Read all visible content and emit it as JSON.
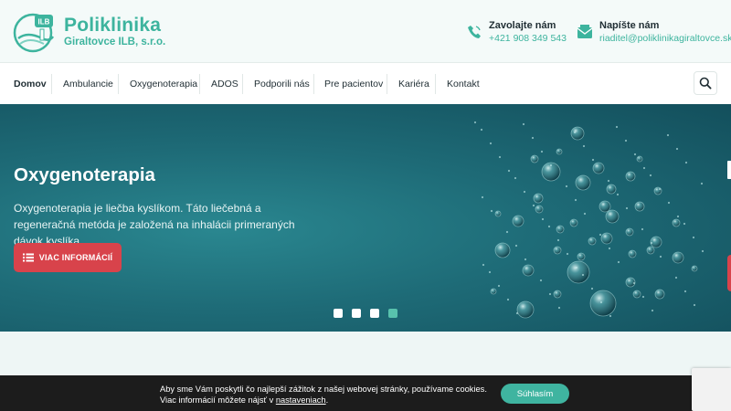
{
  "brand": {
    "title": "Poliklinika",
    "subtitle": "Giraltovce ILB, s.r.o.",
    "logo_text": "ILB"
  },
  "contact": {
    "phone": {
      "title": "Zavolajte nám",
      "value": "+421 908 349 543",
      "icon": "phone-icon"
    },
    "email": {
      "title": "Napíšte nám",
      "value": "riaditel@poliklinikagiraltovce.sk",
      "icon": "mail-icon"
    }
  },
  "nav": {
    "items": [
      {
        "label": "Domov",
        "active": true
      },
      {
        "label": "Ambulancie"
      },
      {
        "label": "Oxygenoterapia"
      },
      {
        "label": "ADOS"
      },
      {
        "label": "Podporili nás"
      },
      {
        "label": "Pre pacientov"
      },
      {
        "label": "Kariéra"
      },
      {
        "label": "Kontakt"
      }
    ],
    "search_icon": "search-icon"
  },
  "hero": {
    "title": "Oxygenoterapia",
    "description": "Oxygenoterapia je liečba kyslíkom. Táto liečebná a regeneračná metóda je založená na inhalácii primeraných dávok kyslíka.",
    "button_label": "VIAC INFORMÁCIÍ",
    "button_icon": "list-icon",
    "slides_total": 4,
    "active_slide": 4
  },
  "cookie": {
    "text_before": "Aby sme Vám poskytli čo najlepší zážitok z našej webovej stránky, používame cookies. Viac informácií môžete nájsť v ",
    "link": "nastaveniach",
    "text_after": ".",
    "accept_label": "Súhlasím"
  },
  "colors": {
    "brand": "#3db49e",
    "accent_red": "#d8434b",
    "hero_bg": "#1e6b77",
    "cookie_bg": "#1c1c1c"
  }
}
